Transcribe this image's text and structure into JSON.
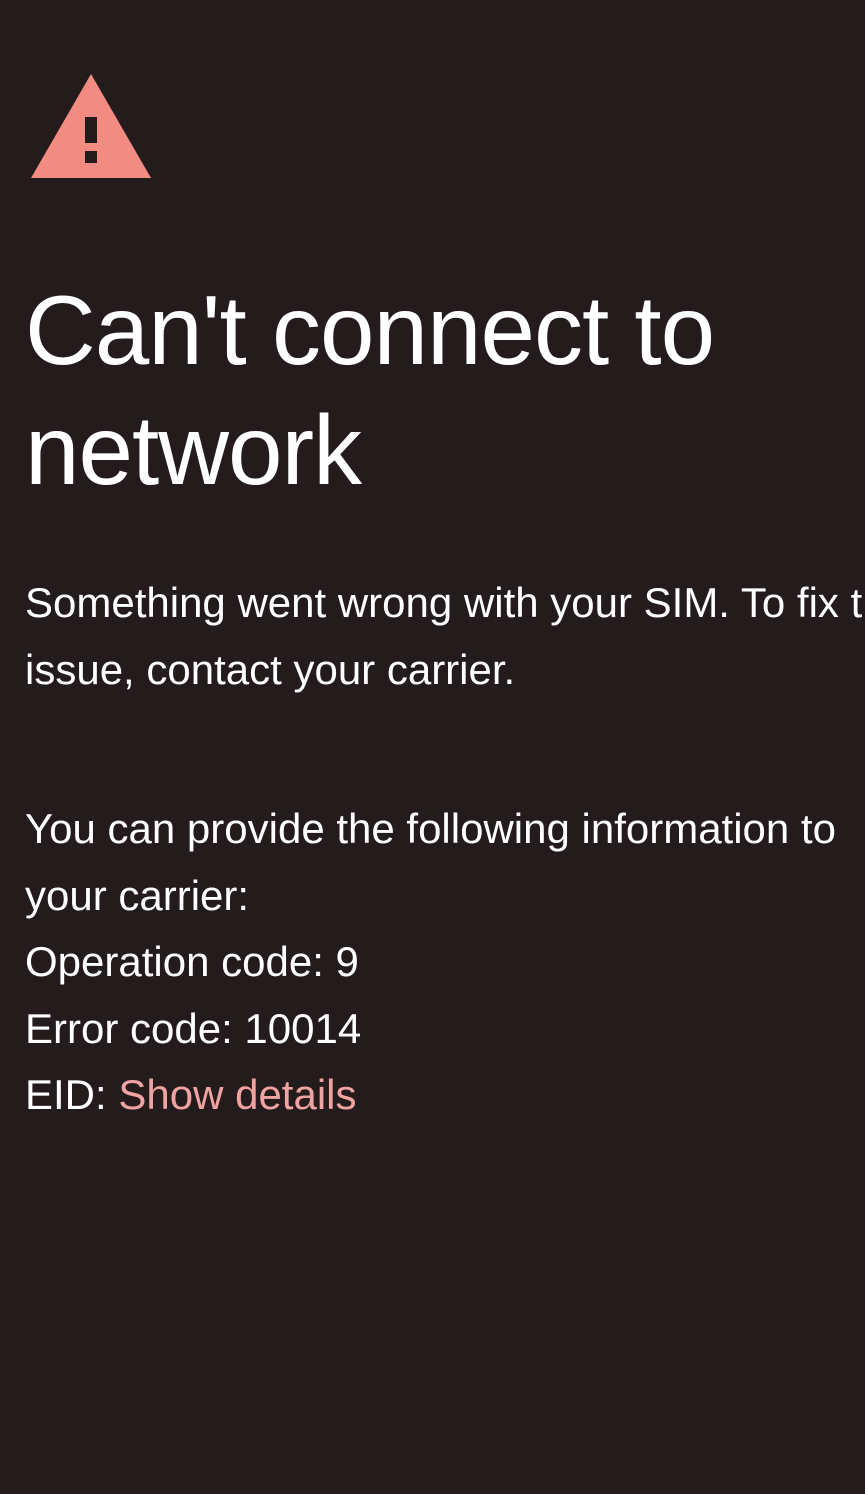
{
  "dialog": {
    "title_line1": "Can't connect to",
    "title_line2": "network",
    "message_line1": "Something went wrong with your SIM. To fix this",
    "message_line2": "issue, contact your carrier.",
    "info_line1": "You can provide the following information to",
    "info_line2": "your carrier:",
    "operation_code": "Operation code: 9",
    "error_code": "Error code: 10014",
    "eid_label": "EID: ",
    "eid_link": "Show details"
  },
  "icon": "warning-triangle-icon",
  "colors": {
    "background": "#241c1c",
    "text": "#ffffff",
    "accent": "#f0a3a0",
    "icon": "#f28b82"
  }
}
